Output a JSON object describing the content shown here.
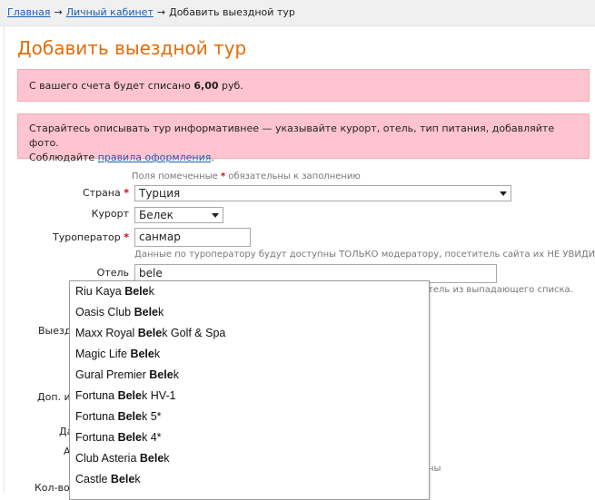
{
  "breadcrumb": {
    "home": "Главная",
    "cabinet": "Личный кабинет",
    "current": "Добавить выездной тур",
    "arrow": "→"
  },
  "page": {
    "title": "Добавить выездной тур"
  },
  "notice1": {
    "text_before": "С вашего счета будет списано ",
    "amount": "6,00",
    "text_after": " руб."
  },
  "notice2": {
    "line1": "Старайтесь описывать тур информативнее  — указывайте курорт, отель, тип питания, добавляйте фото.",
    "line2_before": "Соблюдайте ",
    "rules_link": "правила оформления",
    "line2_after": "."
  },
  "form": {
    "required_hint_before": "Поля помеченные ",
    "required_hint_star": "*",
    "required_hint_after": " обязательны к заполнению",
    "required_star": "*",
    "country_label": "Страна",
    "country_value": "Турция",
    "resort_label": "Курорт",
    "resort_value": "Белек",
    "operator_label": "Туроператор",
    "operator_value": "санмар",
    "operator_hint": "Данные по туроператору будут доступны ТОЛЬКО модератору, посетитель сайта их НЕ УВИДИТ!",
    "hotel_label": "Отель",
    "hotel_value": "bele",
    "hotel_hint_partial": "тель из выпадающего списка.",
    "hidden_labels": {
      "departure": "Выезд",
      "extra": "Доп. и",
      "date_partial": "Да",
      "a_partial": "А",
      "count_partial": "Кол-во",
      "right_partial": "ны"
    }
  },
  "autocomplete": [
    {
      "before": "Riu Kaya ",
      "match": "Bele",
      "after": "k"
    },
    {
      "before": "Oasis Club ",
      "match": "Bele",
      "after": "k"
    },
    {
      "before": "Maxx Royal ",
      "match": "Bele",
      "after": "k Golf & Spa"
    },
    {
      "before": "Magic Life ",
      "match": "Bele",
      "after": "k"
    },
    {
      "before": "Gural Premier ",
      "match": "Bele",
      "after": "k"
    },
    {
      "before": "Fortuna ",
      "match": "Bele",
      "after": "k HV-1"
    },
    {
      "before": "Fortuna ",
      "match": "Bele",
      "after": "k 5*"
    },
    {
      "before": "Fortuna ",
      "match": "Bele",
      "after": "k 4*"
    },
    {
      "before": "Club Asteria ",
      "match": "Bele",
      "after": "k"
    },
    {
      "before": "Castle ",
      "match": "Bele",
      "after": "k"
    }
  ]
}
